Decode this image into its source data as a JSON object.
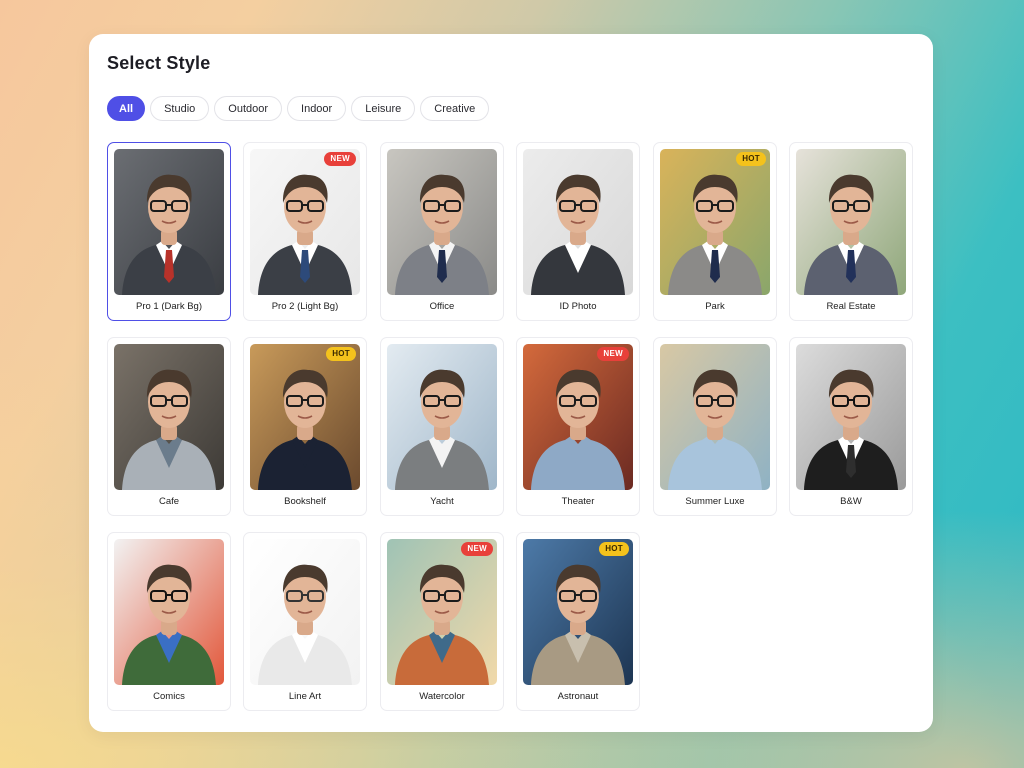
{
  "header": {
    "title": "Select Style"
  },
  "tabs": [
    {
      "label": "All",
      "active": true
    },
    {
      "label": "Studio",
      "active": false
    },
    {
      "label": "Outdoor",
      "active": false
    },
    {
      "label": "Indoor",
      "active": false
    },
    {
      "label": "Leisure",
      "active": false
    },
    {
      "label": "Creative",
      "active": false
    }
  ],
  "colors": {
    "accent": "#4f4fe6",
    "new_badge": "#e8403a",
    "hot_badge": "#f4c21c"
  },
  "styles": [
    {
      "label": "Pro 1 (Dark Bg)",
      "badge": "",
      "selected": true,
      "bg": "#3a3d42",
      "bg2": "#6b6e73",
      "suit": "#3b3f46",
      "tie": "#b8322a",
      "shirt": "#ffffff",
      "frame": "#1b1b1b"
    },
    {
      "label": "Pro 2 (Light Bg)",
      "badge": "NEW",
      "selected": false,
      "bg": "#e7e7e7",
      "bg2": "#f7f7f7",
      "suit": "#3b3f46",
      "tie": "#2d4a7a",
      "shirt": "#ffffff",
      "frame": "#1b1b1b"
    },
    {
      "label": "Office",
      "badge": "",
      "selected": false,
      "bg": "#8a8a88",
      "bg2": "#c8c6c0",
      "suit": "#7d8087",
      "tie": "#1f2c4d",
      "shirt": "#f4f4f4",
      "frame": "#1b1b1b"
    },
    {
      "label": "ID Photo",
      "badge": "",
      "selected": false,
      "bg": "#d8d8d8",
      "bg2": "#ececec",
      "suit": "#34373d",
      "tie": "",
      "shirt": "#ffffff",
      "frame": "#1b1b1b"
    },
    {
      "label": "Park",
      "badge": "HOT",
      "selected": false,
      "bg": "#8aa66b",
      "bg2": "#d9b35a",
      "suit": "#8b8a88",
      "tie": "#1f2c4d",
      "shirt": "#ffffff",
      "frame": "#1b1b1b"
    },
    {
      "label": "Real Estate",
      "badge": "",
      "selected": false,
      "bg": "#8fa77a",
      "bg2": "#e6e2da",
      "suit": "#5c6170",
      "tie": "#22315a",
      "shirt": "#ffffff",
      "frame": "#1b1b1b"
    },
    {
      "label": "Cafe",
      "badge": "",
      "selected": false,
      "bg": "#3d3a36",
      "bg2": "#7a7268",
      "suit": "#a9b0b7",
      "tie": "",
      "shirt": "#6b7c8c",
      "frame": "#1b1b1b"
    },
    {
      "label": "Bookshelf",
      "badge": "HOT",
      "selected": false,
      "bg": "#6b4a2e",
      "bg2": "#c89a5a",
      "suit": "#1b2233",
      "tie": "",
      "shirt": "#1b2233",
      "frame": "#1b1b1b"
    },
    {
      "label": "Yacht",
      "badge": "",
      "selected": false,
      "bg": "#9fb6c9",
      "bg2": "#e3ebf1",
      "suit": "#7b7e80",
      "tie": "",
      "shirt": "#f3f3f3",
      "frame": "#1b1b1b"
    },
    {
      "label": "Theater",
      "badge": "NEW",
      "selected": false,
      "bg": "#6b2a22",
      "bg2": "#d46a3c",
      "suit": "#8ea9c6",
      "tie": "",
      "shirt": "#8ea9c6",
      "frame": "#1b1b1b"
    },
    {
      "label": "Summer Luxe",
      "badge": "",
      "selected": false,
      "bg": "#8fb2c4",
      "bg2": "#d8c8a4",
      "suit": "#a8c4dc",
      "tie": "",
      "shirt": "#a8c4dc",
      "frame": "#1b1b1b"
    },
    {
      "label": "B&W",
      "badge": "",
      "selected": false,
      "bg": "#9a9a9a",
      "bg2": "#dcdcdc",
      "suit": "#1e1e1e",
      "tie": "#2e2e2e",
      "shirt": "#ffffff",
      "frame": "#111111"
    },
    {
      "label": "Comics",
      "badge": "",
      "selected": false,
      "bg": "#e2573a",
      "bg2": "#f2f2f2",
      "suit": "#3f6b3a",
      "tie": "",
      "shirt": "#3a6fc4",
      "frame": "#111111"
    },
    {
      "label": "Line Art",
      "badge": "",
      "selected": false,
      "bg": "#f2f2f2",
      "bg2": "#ffffff",
      "suit": "#e9e9e9",
      "tie": "",
      "shirt": "#ffffff",
      "frame": "#333333"
    },
    {
      "label": "Watercolor",
      "badge": "NEW",
      "selected": false,
      "bg": "#f1d9a9",
      "bg2": "#9fc3b5",
      "suit": "#c86b3a",
      "tie": "",
      "shirt": "#3f6a8a",
      "frame": "#1b1b1b"
    },
    {
      "label": "Astronaut",
      "badge": "HOT",
      "selected": false,
      "bg": "#1d3552",
      "bg2": "#4d7aa8",
      "suit": "#a89a83",
      "tie": "",
      "shirt": "#c8bfae",
      "frame": "#1b1b1b"
    }
  ]
}
